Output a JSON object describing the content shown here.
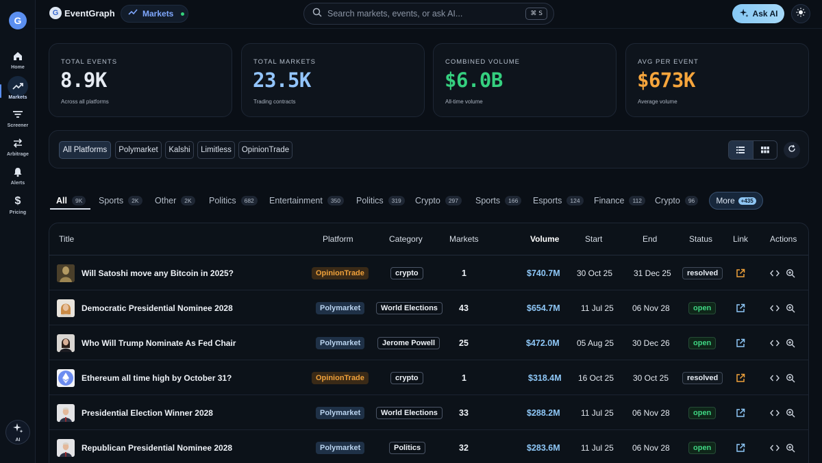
{
  "sidebar": {
    "items": [
      {
        "label": "Home",
        "icon": "home-icon"
      },
      {
        "label": "Markets",
        "icon": "trending-icon"
      },
      {
        "label": "Screener",
        "icon": "filter-icon"
      },
      {
        "label": "Arbitrage",
        "icon": "arrows-icon"
      },
      {
        "label": "Alerts",
        "icon": "bell-icon"
      },
      {
        "label": "Pricing",
        "icon": "dollar-icon"
      }
    ],
    "ai_label": "AI"
  },
  "header": {
    "brand": "EventGraph",
    "section": "Markets",
    "search_placeholder": "Search markets, events, or ask AI...",
    "search_shortcut": "⌘ S",
    "ask_ai": "Ask AI"
  },
  "stats": [
    {
      "label": "TOTAL EVENTS",
      "value": "8.9K",
      "sub": "Across all platforms",
      "color": "#e6ebf2"
    },
    {
      "label": "TOTAL MARKETS",
      "value": "23.5K",
      "sub": "Trading contracts",
      "color": "#93c5fd"
    },
    {
      "label": "COMBINED VOLUME",
      "value": "$6.0B",
      "sub": "All-time volume",
      "color": "#35d07f"
    },
    {
      "label": "AVG PER EVENT",
      "value": "$673K",
      "sub": "Average volume",
      "color": "#f6a53c"
    }
  ],
  "platforms": [
    "All Platforms",
    "Polymarket",
    "Kalshi",
    "Limitless",
    "OpinionTrade"
  ],
  "categories": [
    {
      "label": "All",
      "count": "9K"
    },
    {
      "label": "Sports",
      "count": "2K"
    },
    {
      "label": "Other",
      "count": "2K"
    },
    {
      "label": "Politics",
      "count": "682"
    },
    {
      "label": "Entertainment",
      "count": "350"
    },
    {
      "label": "Politics",
      "count": "319"
    },
    {
      "label": "Crypto",
      "count": "297"
    },
    {
      "label": "Sports",
      "count": "166"
    },
    {
      "label": "Esports",
      "count": "124"
    },
    {
      "label": "Finance",
      "count": "112"
    },
    {
      "label": "Crypto",
      "count": "96"
    }
  ],
  "more": {
    "label": "More",
    "count": "+435"
  },
  "table": {
    "headers": {
      "title": "Title",
      "platform": "Platform",
      "category": "Category",
      "markets": "Markets",
      "volume": "Volume",
      "start": "Start",
      "end": "End",
      "status": "Status",
      "link": "Link",
      "actions": "Actions"
    },
    "rows": [
      {
        "title": "Will Satoshi move any Bitcoin in 2025?",
        "platform": "OpinionTrade",
        "category": "crypto",
        "markets": "1",
        "volume": "$740.7M",
        "start": "30 Oct 25",
        "end": "31 Dec 25",
        "status": "resolved"
      },
      {
        "title": "Democratic Presidential Nominee 2028",
        "platform": "Polymarket",
        "category": "World Elections",
        "markets": "43",
        "volume": "$654.7M",
        "start": "11 Jul 25",
        "end": "06 Nov 28",
        "status": "open"
      },
      {
        "title": "Who Will Trump Nominate As Fed Chair",
        "platform": "Polymarket",
        "category": "Jerome Powell",
        "markets": "25",
        "volume": "$472.0M",
        "start": "05 Aug 25",
        "end": "30 Dec 26",
        "status": "open"
      },
      {
        "title": "Ethereum all time high by October 31?",
        "platform": "OpinionTrade",
        "category": "crypto",
        "markets": "1",
        "volume": "$318.4M",
        "start": "16 Oct 25",
        "end": "30 Oct 25",
        "status": "resolved"
      },
      {
        "title": "Presidential Election Winner 2028",
        "platform": "Polymarket",
        "category": "World Elections",
        "markets": "33",
        "volume": "$288.2M",
        "start": "11 Jul 25",
        "end": "06 Nov 28",
        "status": "open"
      },
      {
        "title": "Republican Presidential Nominee 2028",
        "platform": "Polymarket",
        "category": "Politics",
        "markets": "32",
        "volume": "$283.6M",
        "start": "11 Jul 25",
        "end": "06 Nov 28",
        "status": "open"
      }
    ]
  }
}
